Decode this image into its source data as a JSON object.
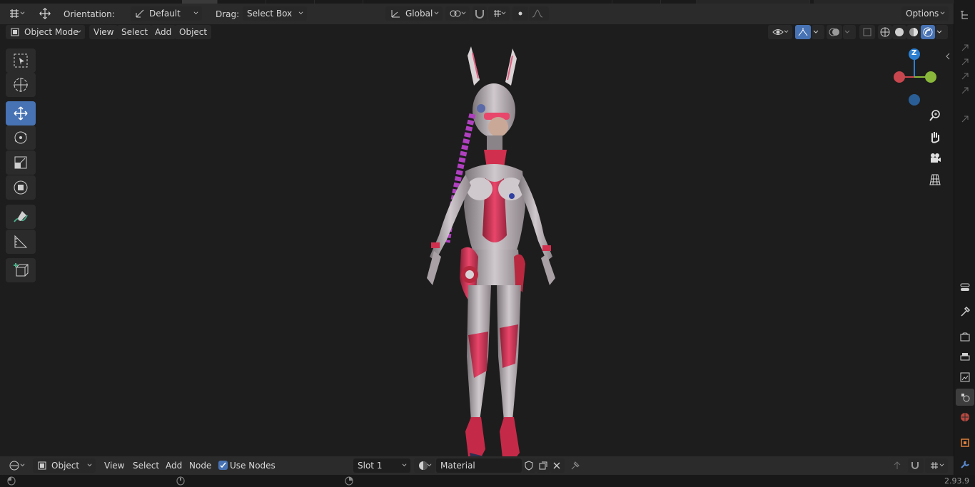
{
  "header": {
    "orientation_label": "Orientation:",
    "orientation_value": "Default",
    "drag_label": "Drag:",
    "drag_value": "Select Box",
    "transform_space": "Global",
    "options_label": "Options"
  },
  "viewport_header": {
    "mode": "Object Mode",
    "menus": [
      "View",
      "Select",
      "Add",
      "Object"
    ]
  },
  "tools": [
    {
      "name": "select-box-tool",
      "icon": "select-box-icon",
      "active": false
    },
    {
      "name": "cursor-tool",
      "icon": "cursor-icon",
      "active": false
    },
    {
      "name": "move-tool",
      "icon": "move-icon",
      "active": true
    },
    {
      "name": "rotate-tool",
      "icon": "rotate-icon",
      "active": false
    },
    {
      "name": "scale-tool",
      "icon": "scale-icon",
      "active": false
    },
    {
      "name": "transform-tool",
      "icon": "transform-icon",
      "active": false
    },
    {
      "name": "annotate-tool",
      "icon": "annotate-icon",
      "active": false
    },
    {
      "name": "measure-tool",
      "icon": "measure-icon",
      "active": false
    },
    {
      "name": "add-cube-tool",
      "icon": "add-cube-icon",
      "active": false
    }
  ],
  "gizmo": {
    "z_label": "Z",
    "x_color": "#c8474f",
    "y_color": "#8ab83a",
    "z_color": "#2c7fd0"
  },
  "footer": {
    "type_value": "Object",
    "menus": [
      "View",
      "Select",
      "Add",
      "Node"
    ],
    "use_nodes_label": "Use Nodes",
    "slot_value": "Slot 1",
    "material_value": "Material"
  },
  "status": {
    "version": "2.93.9"
  },
  "colors": {
    "accent": "#4772b3",
    "panel": "#2b2b2b",
    "viewport": "#1d1d1d"
  }
}
